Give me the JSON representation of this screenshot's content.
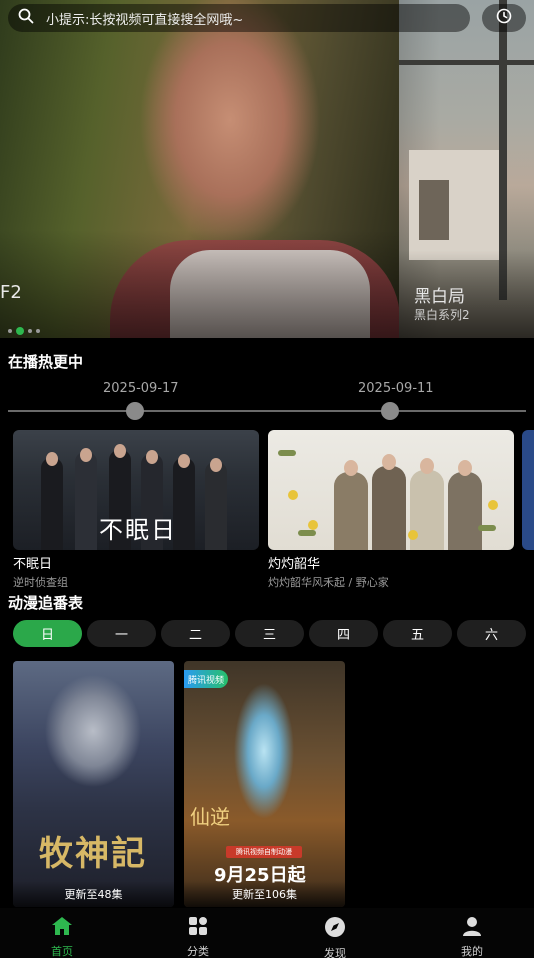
{
  "search": {
    "placeholder": "小提示:长按视频可直接搜全网哦~"
  },
  "banner": {
    "main_title_fragment": "F2",
    "side_title": "黑白局",
    "side_subtitle": "黑白系列2",
    "slide_count": 4,
    "active_index": 1
  },
  "hot": {
    "title": "在播热更中",
    "dates": [
      "2025-09-17",
      "2025-09-11"
    ],
    "items": [
      {
        "title": "不眠日",
        "subtitle": "逆时侦查组",
        "poster_text": "不眠日"
      },
      {
        "title": "灼灼韶华",
        "subtitle": "灼灼韶华风禾起 / 野心家"
      }
    ]
  },
  "anime": {
    "title": "动漫追番表",
    "days": [
      "日",
      "一",
      "二",
      "三",
      "四",
      "五",
      "六"
    ],
    "active_day": 0,
    "items": [
      {
        "update": "更新至48集",
        "poster_text": "牧神記"
      },
      {
        "update": "更新至106集",
        "badge": "腾讯视频",
        "poster_text": "9月25日起",
        "poster_strip": "腾讯视频自制动漫",
        "calligraphy": "仙逆"
      }
    ]
  },
  "nav": {
    "items": [
      {
        "label": "首页",
        "icon": "home-icon"
      },
      {
        "label": "分类",
        "icon": "category-icon"
      },
      {
        "label": "发现",
        "icon": "compass-icon"
      },
      {
        "label": "我的",
        "icon": "user-icon"
      }
    ],
    "active": 0,
    "accent": "#2eb84f"
  }
}
